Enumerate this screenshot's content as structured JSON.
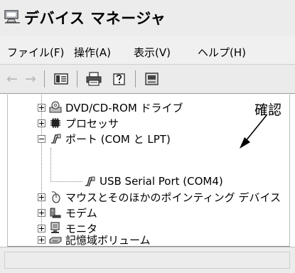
{
  "window": {
    "title": "デバイス マネージャ"
  },
  "menu": {
    "items": [
      "ファイル(F)",
      "操作(A)",
      "表示(V)",
      "ヘルプ(H)"
    ]
  },
  "toolbar": {
    "buttons": [
      "back-arrow-icon",
      "forward-arrow-icon",
      "properties-icon",
      "print-icon",
      "help-icon",
      "update-driver-icon"
    ]
  },
  "tree": {
    "nodes": [
      {
        "label": "DVD/CD-ROM ドライブ",
        "state": "collapsed",
        "icon": "dvd-drive-icon"
      },
      {
        "label": "プロセッサ",
        "state": "collapsed",
        "icon": "processor-icon"
      },
      {
        "label": "ポート (COM と LPT)",
        "state": "expanded",
        "icon": "port-icon",
        "children": [
          {
            "label": "USB Serial Port (COM4)",
            "icon": "port-icon"
          }
        ]
      },
      {
        "label": "マウスとそのほかのポインティング デバイス",
        "state": "collapsed",
        "icon": "mouse-icon"
      },
      {
        "label": "モデム",
        "state": "collapsed",
        "icon": "modem-icon"
      },
      {
        "label": "モニタ",
        "state": "collapsed",
        "icon": "monitor-icon"
      },
      {
        "label": "記憶域ボリューム",
        "state": "collapsed",
        "icon": "storage-volume-icon"
      }
    ]
  },
  "annotation": {
    "text": "確認"
  }
}
